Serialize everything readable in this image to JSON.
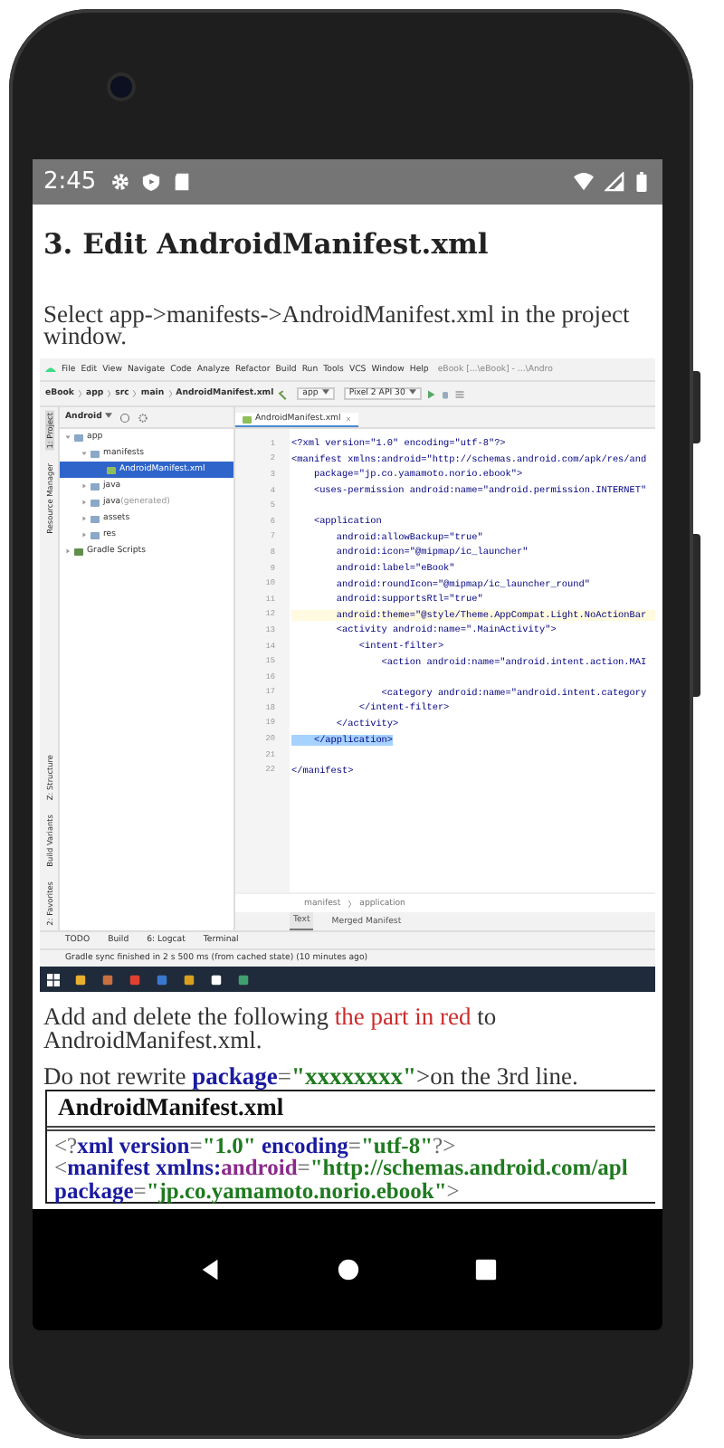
{
  "status_bar": {
    "time": "2:45"
  },
  "article": {
    "heading": "3. Edit AndroidManifest.xml",
    "intro": "Select app->manifests->AndroidManifest.xml in the project window.",
    "ide": {
      "menu": [
        "File",
        "Edit",
        "View",
        "Navigate",
        "Code",
        "Analyze",
        "Refactor",
        "Build",
        "Run",
        "Tools",
        "VCS",
        "Window",
        "Help"
      ],
      "title": "eBook [...\\eBook] - ...\\Andro",
      "breadcrumbs": [
        "eBook",
        "app",
        "src",
        "main",
        "AndroidManifest.xml"
      ],
      "run_config": "app",
      "device": "Pixel 2 API 30",
      "side_tabs_top": [
        {
          "label": "1: Project",
          "selected": true
        },
        {
          "label": "Resource Manager",
          "selected": false
        }
      ],
      "side_tabs_bottom": [
        {
          "label": "Z: Structure",
          "selected": false
        },
        {
          "label": "Build Variants",
          "selected": false
        },
        {
          "label": "2: Favorites",
          "selected": false
        }
      ],
      "project_view": "Android",
      "file_tab": "AndroidManifest.xml",
      "tree": [
        {
          "label": "app",
          "kind": "folder",
          "expanded": true,
          "selected": false,
          "children": [
            {
              "label": "manifests",
              "kind": "folder",
              "expanded": true,
              "selected": false,
              "children": [
                {
                  "label": "AndroidManifest.xml",
                  "kind": "file",
                  "selected": true
                }
              ]
            },
            {
              "label": "java",
              "kind": "folder",
              "expanded": false,
              "selected": false
            },
            {
              "label": "java",
              "note": "(generated)",
              "kind": "folder",
              "expanded": false,
              "selected": false
            },
            {
              "label": "assets",
              "kind": "folder",
              "expanded": false,
              "selected": false
            },
            {
              "label": "res",
              "kind": "folder",
              "expanded": false,
              "selected": false
            }
          ]
        },
        {
          "label": "Gradle Scripts",
          "kind": "gradle",
          "expanded": false,
          "selected": false
        }
      ],
      "lines": [
        {
          "number": "1",
          "text": "<?xml version=\"1.0\" encoding=\"utf-8\"?>",
          "current": false,
          "selected": false
        },
        {
          "number": "2",
          "text": "<manifest xmlns:android=\"http://schemas.android.com/apk/res/and",
          "current": false,
          "selected": false
        },
        {
          "number": "3",
          "text": "    package=\"jp.co.yamamoto.norio.ebook\">",
          "current": false,
          "selected": false
        },
        {
          "number": "4",
          "text": "    <uses-permission android:name=\"android.permission.INTERNET\"",
          "current": false,
          "selected": false
        },
        {
          "number": "5"
        },
        {
          "number": "6",
          "text": "    <application",
          "current": false,
          "selected": false
        },
        {
          "number": "7",
          "text": "        android:allowBackup=\"true\"",
          "current": false,
          "selected": false
        },
        {
          "number": "8",
          "text": "        android:icon=\"@mipmap/ic_launcher\"",
          "current": false,
          "selected": false
        },
        {
          "number": "9",
          "text": "        android:label=\"eBook\"",
          "current": false,
          "selected": false
        },
        {
          "number": "10",
          "text": "        android:roundIcon=\"@mipmap/ic_launcher_round\"",
          "current": false,
          "selected": false
        },
        {
          "number": "11",
          "text": "        android:supportsRtl=\"true\"",
          "current": false,
          "selected": false
        },
        {
          "number": "12",
          "text": "        android:theme=\"@style/Theme.AppCompat.Light.NoActionBar",
          "current": true,
          "selected": false
        },
        {
          "number": "13",
          "text": "        <activity android:name=\".MainActivity\">",
          "current": false,
          "selected": false
        },
        {
          "number": "14",
          "text": "            <intent-filter>",
          "current": false,
          "selected": false
        },
        {
          "number": "15",
          "text": "                <action android:name=\"android.intent.action.MAI",
          "current": false,
          "selected": false
        },
        {
          "number": "16"
        },
        {
          "number": "17",
          "text": "                <category android:name=\"android.intent.category",
          "current": false,
          "selected": false
        },
        {
          "number": "18",
          "text": "            </intent-filter>",
          "current": false,
          "selected": false
        },
        {
          "number": "19",
          "text": "        </activity>",
          "current": false,
          "selected": false
        },
        {
          "number": "20",
          "text": "    </application>",
          "current": false,
          "selected": true
        },
        {
          "number": "21"
        },
        {
          "number": "22",
          "text": "</manifest>",
          "current": false,
          "selected": false
        }
      ],
      "path": [
        "manifest",
        "application"
      ],
      "editor_tabs": [
        {
          "label": "Text",
          "selected": true
        },
        {
          "label": "Merged Manifest",
          "selected": false
        }
      ],
      "tool_tabs": [
        "TODO",
        "Build",
        "6: Logcat",
        "Terminal"
      ],
      "status": "Gradle sync finished in 2 s 500 ms (from cached state) (10 minutes ago)"
    },
    "instruction": [
      {
        "text": "Add and delete the following ",
        "kind": "plain"
      },
      {
        "text": "the part in red",
        "kind": "red"
      },
      {
        "text": " to AndroidManifest.xml.",
        "kind": "plain"
      }
    ],
    "note": [
      {
        "text": "Do not rewrite ",
        "kind": "plain"
      },
      {
        "text": "package",
        "kind": "tag"
      },
      {
        "text": "=",
        "kind": "punct"
      },
      {
        "text": "\"xxxxxxxx\"",
        "kind": "value"
      },
      {
        "text": ">on the 3rd line.",
        "kind": "plain"
      }
    ],
    "listing": {
      "title": "AndroidManifest.xml",
      "lines": [
        [
          {
            "text": "<?",
            "kind": "punct"
          },
          {
            "text": "xml version",
            "kind": "tag"
          },
          {
            "text": "=",
            "kind": "punct"
          },
          {
            "text": "\"1.0\"",
            "kind": "value"
          },
          {
            "text": " encoding",
            "kind": "tag"
          },
          {
            "text": "=",
            "kind": "punct"
          },
          {
            "text": "\"utf-8\"",
            "kind": "value"
          },
          {
            "text": "?>",
            "kind": "punct"
          }
        ],
        [
          {
            "text": "<",
            "kind": "punct"
          },
          {
            "text": "manifest xmlns:",
            "kind": "tag"
          },
          {
            "text": "android",
            "kind": "attr"
          },
          {
            "text": "=",
            "kind": "punct"
          },
          {
            "text": "\"http://schemas.android.com/apl",
            "kind": "value"
          }
        ],
        [
          {
            "text": "package",
            "kind": "tag"
          },
          {
            "text": "=",
            "kind": "punct"
          },
          {
            "text": "\"jp.co.yamamoto.norio.ebook\"",
            "kind": "value"
          },
          {
            "text": ">",
            "kind": "punct"
          }
        ]
      ]
    }
  }
}
